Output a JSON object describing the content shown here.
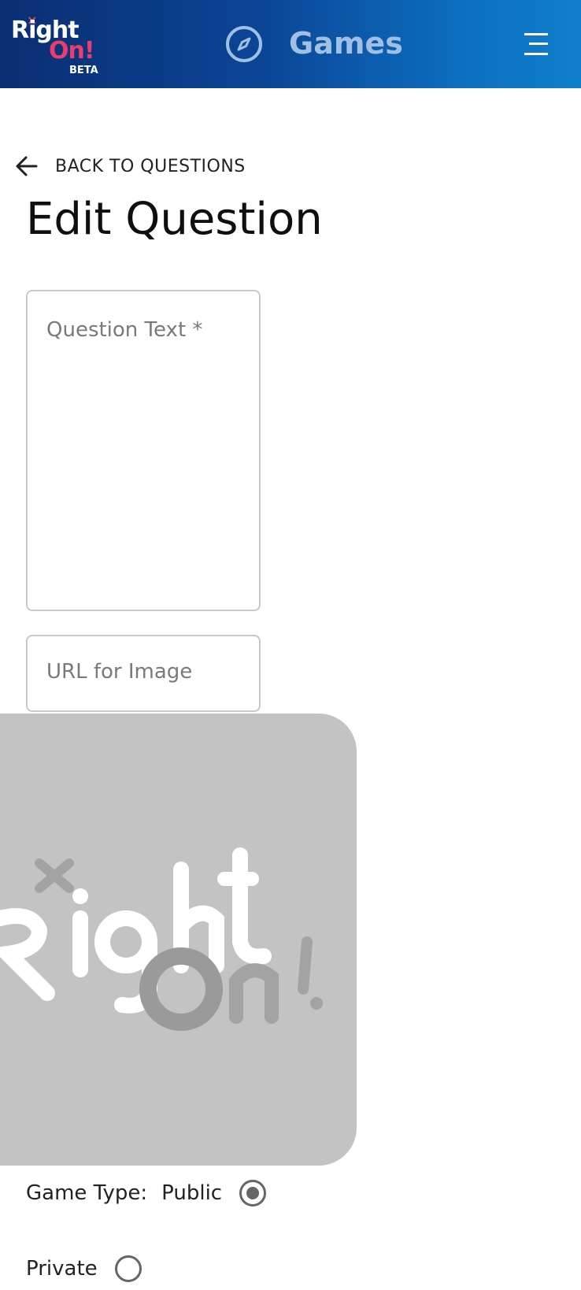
{
  "header": {
    "logo": {
      "line1": "Right",
      "line2": "On!",
      "badge": "BETA"
    },
    "title": "Games",
    "icons": {
      "nav": "compass-icon",
      "menu": "hamburger-menu-icon"
    },
    "colors": {
      "gradient_start": "#0a2e72",
      "gradient_end": "#0f7fcc",
      "accent": "#ea3c6d"
    }
  },
  "nav": {
    "back_label": "BACK TO QUESTIONS"
  },
  "page": {
    "title": "Edit Question"
  },
  "form": {
    "question_text": {
      "placeholder": "Question Text *",
      "value": ""
    },
    "image_url": {
      "placeholder": "URL for Image",
      "value": ""
    },
    "image_preview": {
      "alt": "Right On!"
    },
    "game_type": {
      "label": "Game Type:",
      "options": [
        {
          "label": "Public",
          "selected": true
        },
        {
          "label": "Private",
          "selected": false
        }
      ]
    }
  }
}
